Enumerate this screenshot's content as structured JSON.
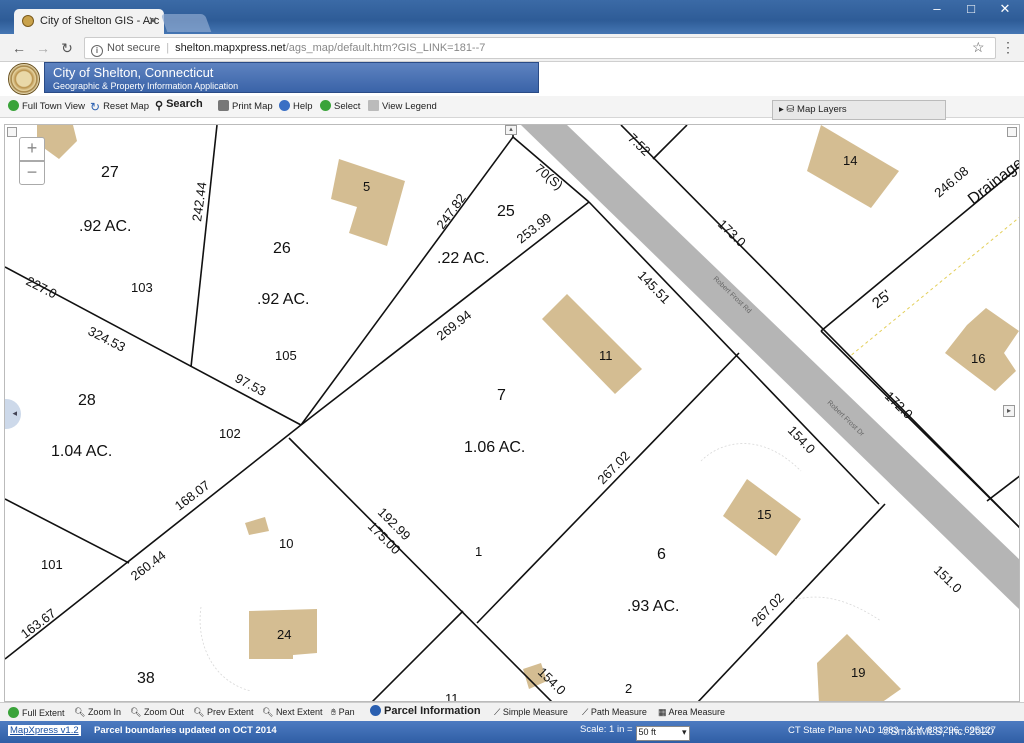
{
  "browser": {
    "tab_title": "City of Shelton GIS - Arc",
    "security_label": "Not secure",
    "url_host": "shelton.mapxpress.net",
    "url_path": "/ags_map/default.htm?GIS_LINK=181--7"
  },
  "app": {
    "title": "City of Shelton, Connecticut",
    "subtitle": "Geographic & Property Information Application"
  },
  "toolbar": {
    "full_town_view": "Full Town View",
    "reset_map": "Reset Map",
    "search": "Search",
    "print_map": "Print Map",
    "help": "Help",
    "select": "Select",
    "view_legend": "View Legend",
    "map_layers": "Map Layers"
  },
  "map": {
    "zoom_in": "+",
    "zoom_out": "−",
    "street_labels": [
      "Robert Frost Rd",
      "Robert Frost Dr"
    ],
    "labels": {
      "p27": "27",
      "p27_area": ".92 AC.",
      "p26": "26",
      "p26_area": ".92 AC.",
      "p25": "25",
      "p25_area": ".22 AC.",
      "p28": "28",
      "p28_area": "1.04 AC.",
      "p7": "7",
      "p7_area": "1.06 AC.",
      "p6": "6",
      "p6_area": ".93 AC.",
      "p38": "38",
      "drainage": "Drainage",
      "width25": "25'",
      "n103": "103",
      "n105": "105",
      "n102": "102",
      "n101": "101",
      "n10": "10",
      "n1": "1",
      "n2": "2",
      "n11b": "11",
      "d24244": "242.44",
      "d24782": "247.82",
      "d70s": "70(S)",
      "d25399": "253.99",
      "d752": "7.52",
      "d1730": "173.0",
      "d24608": "246.08",
      "d2270": "227.0",
      "d32453": "324.53",
      "d26994": "269.94",
      "d14551": "145.51",
      "d9753": "97.53",
      "d1720": "172.0",
      "d1540a": "154.0",
      "d26702a": "267.02",
      "d16807": "168.07",
      "d19299": "192.99",
      "d17500": "175.00",
      "d26044": "260.44",
      "d16367": "163.67",
      "d1510": "151.0",
      "d26702b": "267.02",
      "d1540b": "154.0"
    },
    "buildings": [
      "5",
      "14",
      "11",
      "16",
      "15",
      "24",
      "19"
    ]
  },
  "bottom_toolbar": {
    "full_extent": "Full Extent",
    "zoom_in": "Zoom In",
    "zoom_out": "Zoom Out",
    "prev_extent": "Prev Extent",
    "next_extent": "Next Extent",
    "pan": "Pan",
    "parcel_information": "Parcel Information",
    "simple_measure": "Simple Measure",
    "path_measure": "Path Measure",
    "area_measure": "Area Measure"
  },
  "status": {
    "version": "MapXpress v1.2",
    "parcel_updated": "Parcel boundaries updated on OCT 2014",
    "scale_label": "Scale: 1 in =",
    "scale_value": "50 ft",
    "coords": "CT State Plane NAD 1983 - X,Y: 883296, 695127",
    "watermark": "©SmartMLS, Inc. 2020"
  },
  "colors": {
    "banner": "#3a63a8",
    "building": "#d4bd92",
    "road": "#b5b5b5",
    "status_bar": "#2f5ea5"
  }
}
